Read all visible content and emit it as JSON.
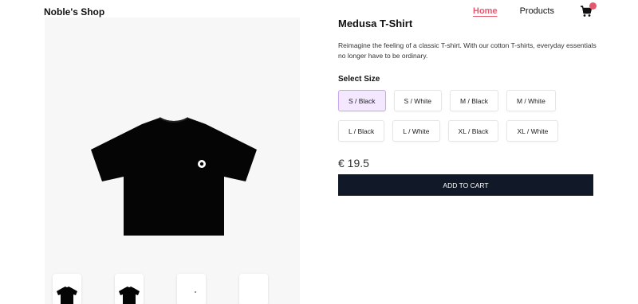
{
  "header": {
    "brand": "Noble's Shop",
    "nav": [
      {
        "label": "Home",
        "active": true
      },
      {
        "label": "Products",
        "active": false
      }
    ],
    "cart": {
      "icon": "cart-icon",
      "count": ""
    }
  },
  "gallery": {
    "main_image": "black-tshirt-image",
    "thumbnails": [
      "black-tshirt-front",
      "black-tshirt-back",
      "white-tshirt-front",
      "white-tshirt-back"
    ]
  },
  "product": {
    "title": "Medusa T-Shirt",
    "description": "Reimagine the feeling of a classic T-shirt. With our cotton T-shirts, everyday essentials no longer have to be ordinary.",
    "select_size_label": "Select Size",
    "sizes": [
      "S / Black",
      "S / White",
      "M / Black",
      "M / White",
      "L / Black",
      "L / White",
      "XL / Black",
      "XL / White"
    ],
    "selected_size": "S / Black",
    "price": "€ 19.5",
    "add_to_cart_label": "ADD TO CART"
  },
  "colors": {
    "accent": "#e5576f",
    "button_dark": "#111827",
    "selected_bg": "#f3e8ff"
  }
}
